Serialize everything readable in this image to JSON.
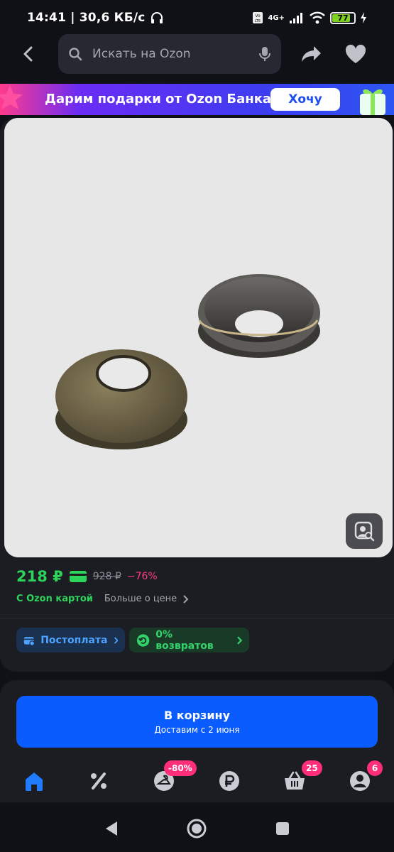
{
  "status_bar": {
    "time_speed": "14:41 | 30,6 КБ/с",
    "network": "4G+",
    "battery": "77"
  },
  "search": {
    "placeholder": "Искать на Ozon"
  },
  "banner": {
    "text": "Дарим подарки от Ozon Банка",
    "button": "Хочу"
  },
  "product": {
    "price": "218 ₽",
    "old_price": "928 ₽",
    "discount": "−76%",
    "card_label": "С Ozon картой",
    "more_price": "Больше о цене"
  },
  "chips": {
    "postpay": "Постоплата",
    "returns": "0% возвратов"
  },
  "cart": {
    "title": "В корзину",
    "delivery": "Доставим с 2 июня"
  },
  "tabbar": {
    "discount_badge": "-80%",
    "cart_badge": "25",
    "profile_badge": "6"
  },
  "colors": {
    "price_green": "#2dd45c",
    "accent_blue": "#0a5cff",
    "badge_pink": "#ff2e78",
    "discount_pink": "#ff3d7f"
  }
}
